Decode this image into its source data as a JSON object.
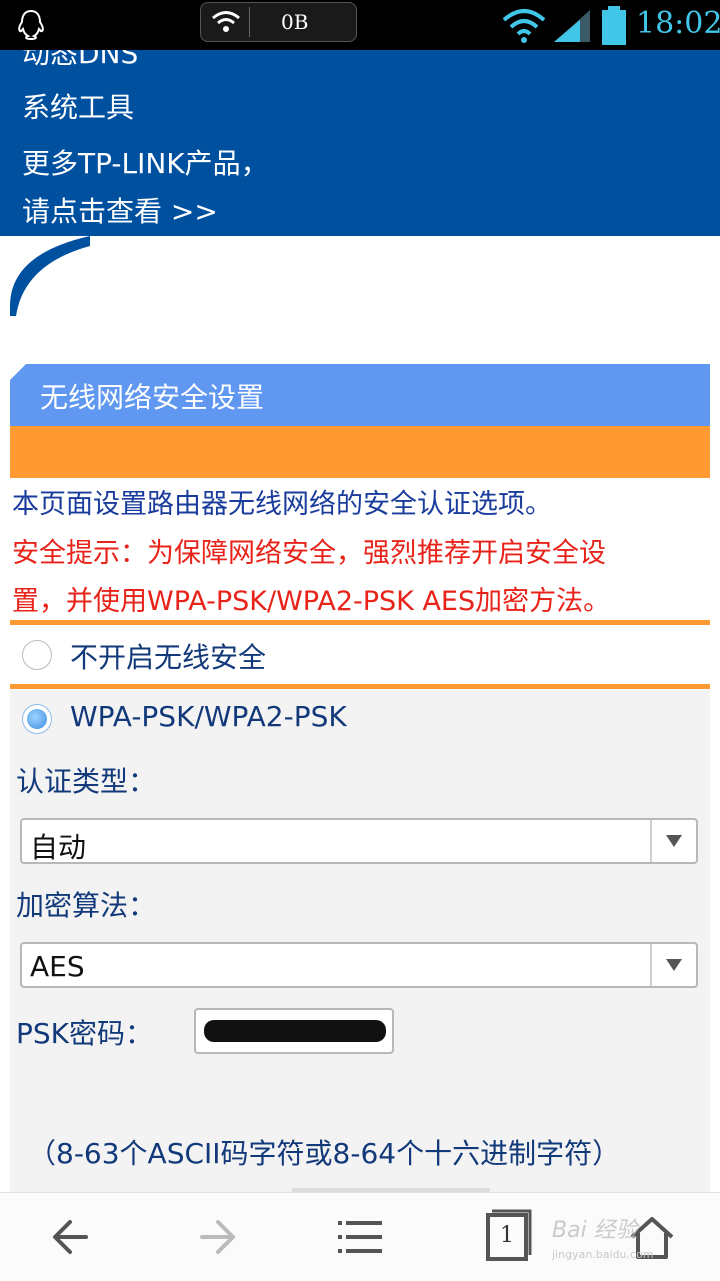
{
  "status_bar": {
    "traffic": "0B",
    "time": "18:02",
    "icons": [
      "qq-icon",
      "wifi-icon",
      "signal-icon",
      "battery-icon"
    ],
    "time_color": "#41c6e8"
  },
  "menu": {
    "items": [
      "动态DNS",
      "系统工具",
      "更多TP-LINK产品，",
      "请点击查看 >>"
    ],
    "background": "#0050a0"
  },
  "section": {
    "title": "无线网络安全设置",
    "description": "本页面设置路由器无线网络的安全认证选项。",
    "warning_line1": "安全提示：为保障网络安全，强烈推荐开启安全设",
    "warning_line2": "置，并使用WPA-PSK/WPA2-PSK AES加密方法。",
    "title_bar_color": "#5f97f1",
    "accent_color": "#ff9a33",
    "warning_color": "#e8231a"
  },
  "options": {
    "no_security": {
      "label": "不开启无线安全",
      "selected": false
    },
    "wpa_psk": {
      "label": "WPA-PSK/WPA2-PSK",
      "selected": true
    }
  },
  "form": {
    "auth_type_label": "认证类型：",
    "auth_type_value": "自动",
    "encryption_label": "加密算法：",
    "encryption_value": "AES",
    "psk_label": "PSK密码：",
    "psk_hint": "（8-63个ASCII码字符或8-64个十六进制字符）"
  },
  "bottom_nav": {
    "tab_count": "1",
    "icons": [
      "back-arrow-icon",
      "forward-arrow-icon",
      "menu-icon",
      "tabs-icon",
      "home-icon"
    ]
  },
  "watermark": {
    "text": "Bai 经验",
    "sub": "jingyan.baidu.com"
  }
}
